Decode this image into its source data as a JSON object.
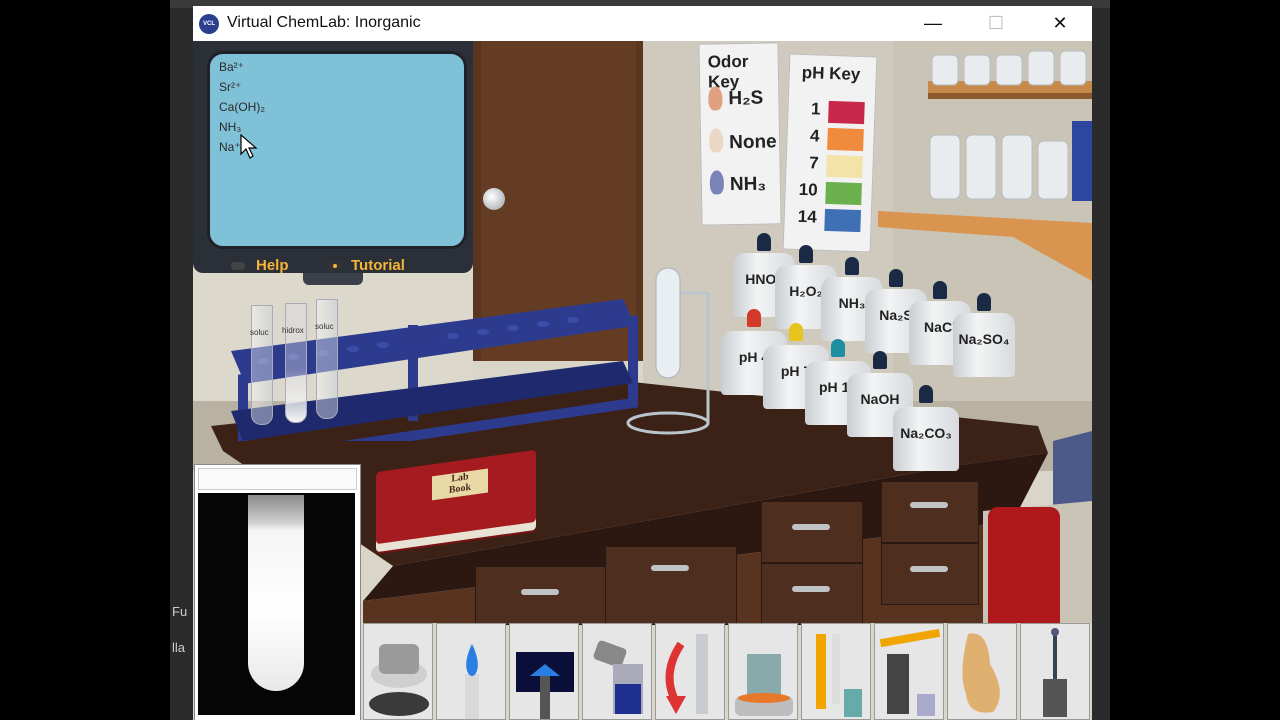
{
  "window": {
    "title": "Virtual ChemLab: Inorganic",
    "minimize": "—",
    "maximize": "☐",
    "close": "✕"
  },
  "background": {
    "edge_text_1": "Fu",
    "edge_text_2": "lla"
  },
  "monitor": {
    "ions": [
      "Ba²⁺",
      "Sr²⁺",
      "Ca(OH)₂",
      "NH₃",
      "Na⁺"
    ],
    "help_label": "Help",
    "tutorial_label": "Tutorial"
  },
  "test_tubes": [
    "soluc",
    "hidrox",
    "soluc"
  ],
  "odor_key": {
    "title": "Odor Key",
    "items": [
      "H₂S",
      "None",
      "NH₃"
    ]
  },
  "ph_key": {
    "title": "pH Key",
    "items": [
      {
        "value": "1",
        "color": "#c8294a"
      },
      {
        "value": "4",
        "color": "#f08a3c"
      },
      {
        "value": "7",
        "color": "#f3e3a8"
      },
      {
        "value": "10",
        "color": "#6ab04c"
      },
      {
        "value": "14",
        "color": "#3f6fb5"
      }
    ]
  },
  "reagents_back": [
    "HNO₃",
    "H₂O₂",
    "NH₃",
    "Na₂S",
    "NaCl",
    "Na₂SO₄"
  ],
  "reagents_front": [
    {
      "label": "pH 4",
      "cap": "#d23a2a"
    },
    {
      "label": "pH 7",
      "cap": "#e6c51e"
    },
    {
      "label": "pH 10",
      "cap": "#1e8fa0"
    },
    {
      "label": "NaOH",
      "cap": "#1a2a45"
    },
    {
      "label": "Na₂CO₃",
      "cap": "#1a2a45"
    }
  ],
  "lab_book": {
    "line1": "Lab",
    "line2": "Book"
  },
  "toolbar": [
    {
      "name": "centrifuge-tool-icon"
    },
    {
      "name": "burner-tool-icon"
    },
    {
      "name": "flame-test-tool-icon"
    },
    {
      "name": "pour-tool-icon"
    },
    {
      "name": "return-tool-icon"
    },
    {
      "name": "hotplate-tool-icon"
    },
    {
      "name": "litmus-tool-icon"
    },
    {
      "name": "ph-paper-tool-icon"
    },
    {
      "name": "smell-tool-icon"
    },
    {
      "name": "stir-rod-tool-icon"
    }
  ],
  "colors": {
    "screen": "#7fc1d6",
    "accent_text": "#f3b437",
    "bench": "#3b2116",
    "rack": "#2d3b8f"
  }
}
